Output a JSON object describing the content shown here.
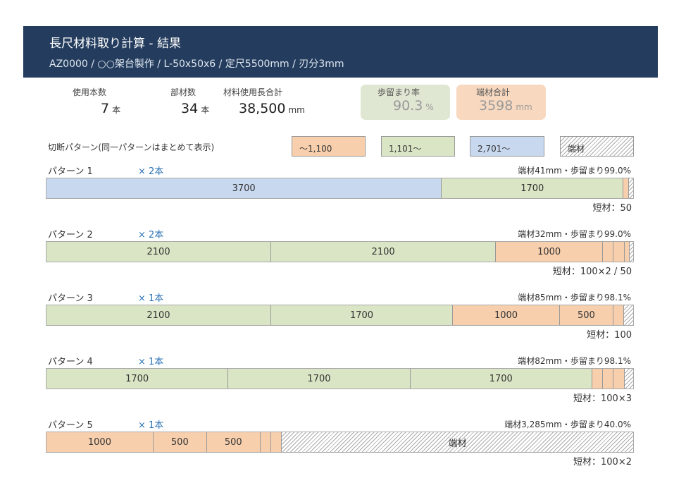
{
  "header": {
    "title": "長尺材料取り計算 - 結果",
    "subtitle": "AZ0000 / ○○架台製作 / L-50x50x6 / 定尺5500mm / 刃分3mm"
  },
  "stats": {
    "count_label": "使用本数",
    "count_value": "7",
    "count_unit": "本",
    "parts_label": "部材数",
    "parts_value": "34",
    "parts_unit": "本",
    "length_label": "材料使用長合計",
    "length_value": "38,500",
    "length_unit": "mm",
    "yield_label": "歩留まり率",
    "yield_value": "90.3",
    "yield_unit": "%",
    "offcut_label": "端材合計",
    "offcut_value": "3598",
    "offcut_unit": "mm"
  },
  "legend": {
    "title": "切断パターン(同一パターンはまとめて表示)",
    "orange": "～1,100",
    "green": "1,101～",
    "blue": "2,701～",
    "offcut": "端材"
  },
  "colors": {
    "header": "#243d5e",
    "green": "#d9e5c4",
    "orange": "#f7cfad",
    "blue": "#c8d8ef",
    "count_text": "#2e74b5"
  },
  "patterns": [
    {
      "title": "パターン 1",
      "count": "× 2本",
      "stat": "端材41mm・歩留まり99.0%",
      "short": "短材：50",
      "segments": [
        {
          "label": "3700",
          "length": 3700,
          "color": "blue"
        },
        {
          "label": "1700",
          "length": 1700,
          "color": "green"
        },
        {
          "label": "",
          "length": 50,
          "color": "orange"
        },
        {
          "label": "",
          "length": 41,
          "color": "hatch"
        }
      ]
    },
    {
      "title": "パターン 2",
      "count": "× 2本",
      "stat": "端材32mm・歩留まり99.0%",
      "short": "短材：100×2 / 50",
      "segments": [
        {
          "label": "2100",
          "length": 2100,
          "color": "green"
        },
        {
          "label": "2100",
          "length": 2100,
          "color": "green"
        },
        {
          "label": "1000",
          "length": 1000,
          "color": "orange"
        },
        {
          "label": "",
          "length": 100,
          "color": "orange"
        },
        {
          "label": "",
          "length": 100,
          "color": "orange"
        },
        {
          "label": "",
          "length": 50,
          "color": "orange"
        },
        {
          "label": "",
          "length": 32,
          "color": "hatch"
        }
      ]
    },
    {
      "title": "パターン 3",
      "count": "× 1本",
      "stat": "端材85mm・歩留まり98.1%",
      "short": "短材：100",
      "segments": [
        {
          "label": "2100",
          "length": 2100,
          "color": "green"
        },
        {
          "label": "1700",
          "length": 1700,
          "color": "green"
        },
        {
          "label": "1000",
          "length": 1000,
          "color": "orange"
        },
        {
          "label": "500",
          "length": 500,
          "color": "orange"
        },
        {
          "label": "",
          "length": 100,
          "color": "orange"
        },
        {
          "label": "",
          "length": 85,
          "color": "hatch"
        }
      ]
    },
    {
      "title": "パターン 4",
      "count": "× 1本",
      "stat": "端材82mm・歩留まり98.1%",
      "short": "短材：100×3",
      "segments": [
        {
          "label": "1700",
          "length": 1700,
          "color": "green"
        },
        {
          "label": "1700",
          "length": 1700,
          "color": "green"
        },
        {
          "label": "1700",
          "length": 1700,
          "color": "green"
        },
        {
          "label": "",
          "length": 100,
          "color": "orange"
        },
        {
          "label": "",
          "length": 100,
          "color": "orange"
        },
        {
          "label": "",
          "length": 100,
          "color": "orange"
        },
        {
          "label": "",
          "length": 82,
          "color": "hatch"
        }
      ]
    },
    {
      "title": "パターン 5",
      "count": "× 1本",
      "stat": "端材3,285mm・歩留まり40.0%",
      "short": "短材：100×2",
      "segments": [
        {
          "label": "1000",
          "length": 1000,
          "color": "orange"
        },
        {
          "label": "500",
          "length": 500,
          "color": "orange"
        },
        {
          "label": "500",
          "length": 500,
          "color": "orange"
        },
        {
          "label": "",
          "length": 100,
          "color": "orange"
        },
        {
          "label": "",
          "length": 100,
          "color": "orange"
        },
        {
          "label": "端材",
          "length": 3285,
          "color": "hatch"
        }
      ]
    }
  ]
}
